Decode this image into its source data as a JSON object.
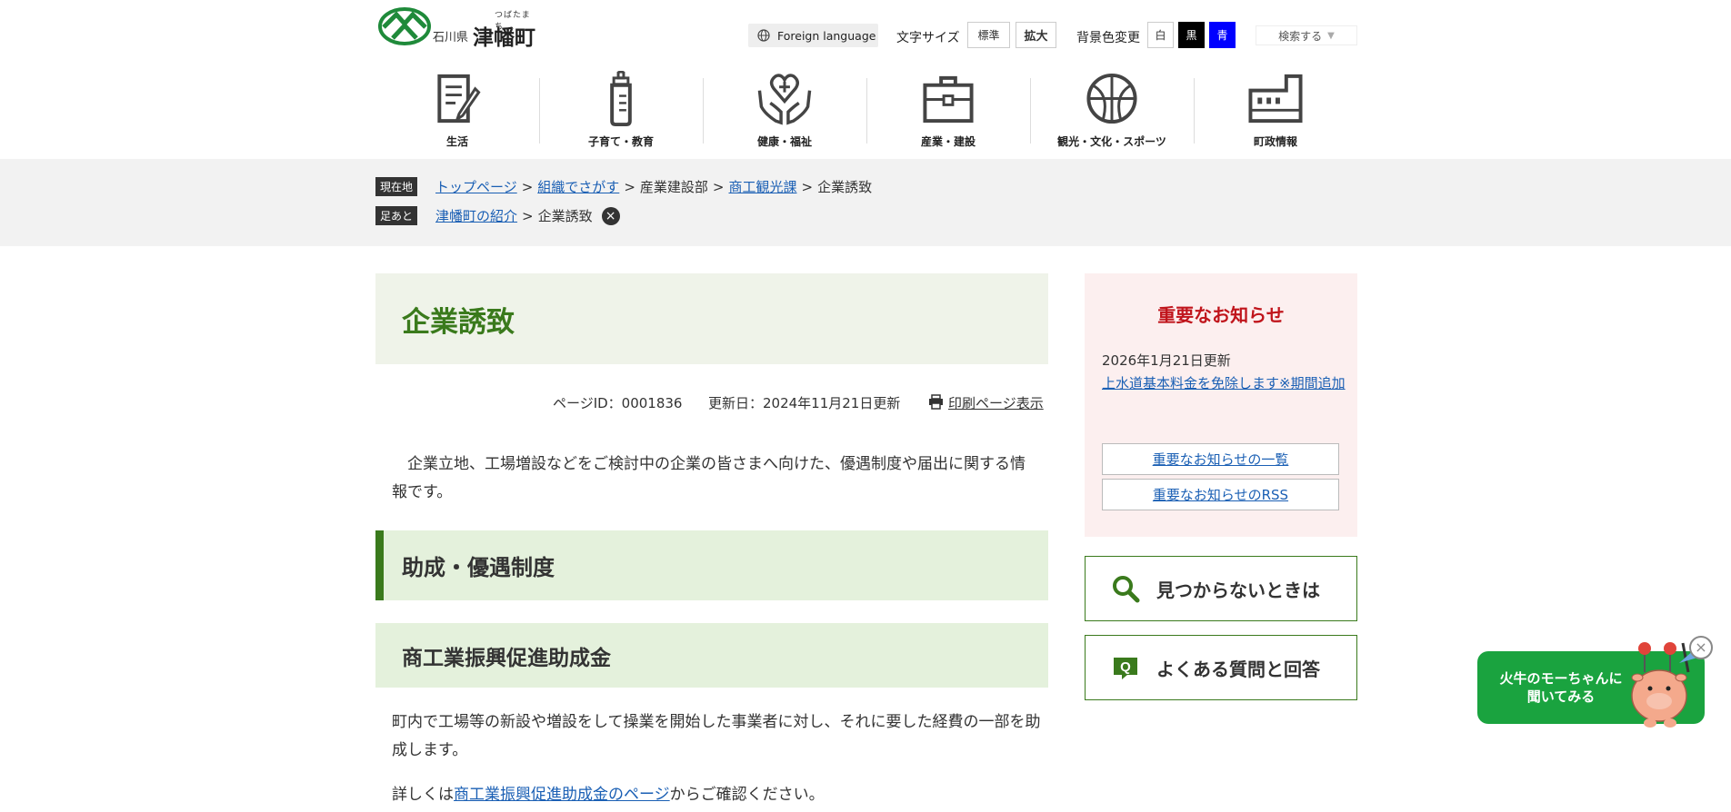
{
  "header": {
    "logo": {
      "pref": "石川県",
      "town": "津幡町",
      "ruby": "つばたまち"
    },
    "foreign_language": "Foreign language",
    "font_size": {
      "label": "文字サイズ",
      "standard": "標準",
      "large": "拡大"
    },
    "bg_color": {
      "label": "背景色変更",
      "white": "白",
      "black": "黒",
      "blue": "青"
    },
    "search_toggle": "検索する"
  },
  "nav": [
    {
      "label": "生活",
      "icon": "document-pen-icon"
    },
    {
      "label": "子育て・教育",
      "icon": "baby-bottle-icon"
    },
    {
      "label": "健康・福祉",
      "icon": "heart-hands-icon"
    },
    {
      "label": "産業・建設",
      "icon": "briefcase-icon"
    },
    {
      "label": "観光・文化・スポーツ",
      "icon": "ball-icon"
    },
    {
      "label": "町政情報",
      "icon": "building-icon"
    }
  ],
  "breadcrumb": {
    "current_tag": "現在地",
    "current": [
      "トップページ",
      "組織でさがす",
      "産業建設部",
      "商工観光課",
      "企業誘致"
    ],
    "footprint_tag": "足あと",
    "footprint": [
      "津幡町の紹介",
      "企業誘致"
    ],
    "separator": ">"
  },
  "page": {
    "title": "企業誘致",
    "page_id": "ページID：0001836",
    "updated": "更新日：2024年11月21日更新",
    "print_link": "印刷ページ表示",
    "intro": "企業立地、工場増設などをご検討中の企業の皆さまへ向けた、優遇制度や届出に関する情報です。",
    "h2": "助成・優遇制度",
    "h3": "商工業振興促進助成金",
    "p1": "町内で工場等の新設や増設をして操業を開始した事業者に対し、それに要した経費の一部を助成します。",
    "p2_prefix": "詳しくは",
    "p2_link": "商工業振興促進助成金のページ",
    "p2_suffix": "からご確認ください。"
  },
  "sidebar": {
    "notice_title": "重要なお知らせ",
    "notice_date": "2026年1月21日更新",
    "notice_link": "上水道基本料金を免除します※期間追加",
    "notice_list": "重要なお知らせの一覧",
    "notice_rss": "重要なお知らせのRSS",
    "not_found": "見つからないときは",
    "faq": "よくある質問と回答"
  },
  "chat": {
    "text_line1": "火牛のモーちゃんに",
    "text_line2": "聞いてみる"
  },
  "colors": {
    "accent_green": "#3a7a1c",
    "light_green": "#e4f1dc",
    "notice_red": "#c0141b",
    "chat_green": "#1aa33f",
    "link_blue": "#1a5fb4"
  }
}
